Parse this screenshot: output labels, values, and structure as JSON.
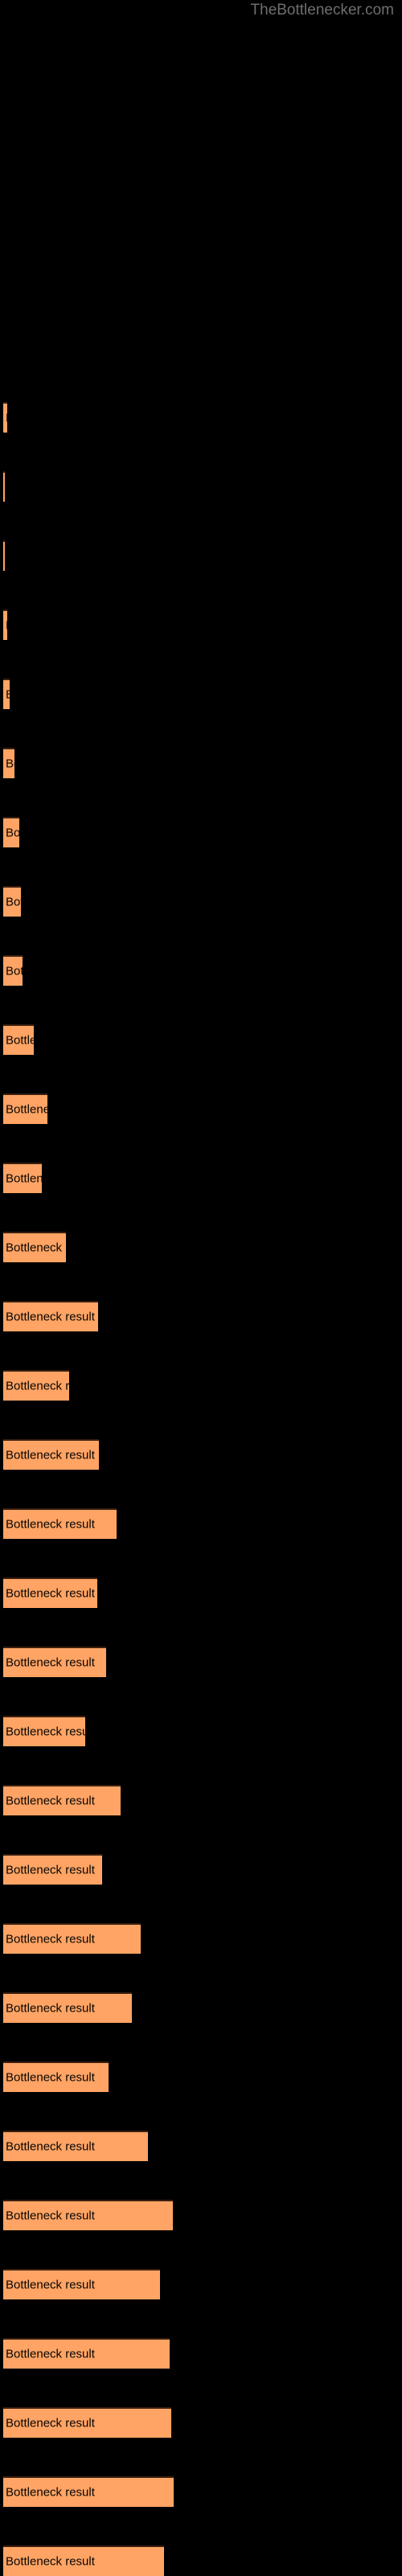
{
  "site": {
    "title": "TheBottlenecker.com"
  },
  "colors": {
    "background": "#000000",
    "bar_fill": "#ffa464",
    "bar_border": "#3a1f10",
    "title_text": "#6e6e6e",
    "bar_label_text": "#0a0604"
  },
  "chart_data": {
    "type": "bar",
    "orientation": "horizontal",
    "title": "",
    "subtitle": "",
    "xlabel": "",
    "ylabel": "",
    "grid": false,
    "legend": false,
    "axis_visible": false,
    "bar_label_text": "Bottleneck result",
    "categories": [
      "Bottleneck result",
      "Bottleneck result",
      "Bottleneck result",
      "Bottleneck result",
      "Bottleneck result",
      "Bottleneck result",
      "Bottleneck result",
      "Bottleneck result",
      "Bottleneck result",
      "Bottleneck result",
      "Bottleneck result",
      "Bottleneck result",
      "Bottleneck result",
      "Bottleneck result",
      "Bottleneck result",
      "Bottleneck result",
      "Bottleneck result",
      "Bottleneck result",
      "Bottleneck result",
      "Bottleneck result",
      "Bottleneck result",
      "Bottleneck result",
      "Bottleneck result",
      "Bottleneck result",
      "Bottleneck result",
      "Bottleneck result",
      "Bottleneck result",
      "Bottleneck result",
      "Bottleneck result",
      "Bottleneck result",
      "Bottleneck result",
      "Bottleneck result"
    ],
    "values": [
      5,
      2,
      2,
      5,
      8,
      14,
      20,
      22,
      24,
      38,
      55,
      48,
      78,
      118,
      82,
      119,
      141,
      117,
      128,
      102,
      146,
      123,
      171,
      160,
      131,
      180,
      211,
      195,
      207,
      209,
      212,
      200
    ],
    "xlim": [
      0,
      250
    ],
    "bar_tops": [
      500,
      586,
      672,
      758,
      844,
      930,
      1016,
      1102,
      1188,
      1274,
      1360,
      1446,
      1532,
      1618,
      1704,
      1790,
      1876,
      1962,
      2048,
      2134,
      2220,
      2306,
      2392,
      2478,
      2564,
      2650,
      2736,
      2822,
      2908,
      2994,
      3080,
      3166
    ]
  }
}
